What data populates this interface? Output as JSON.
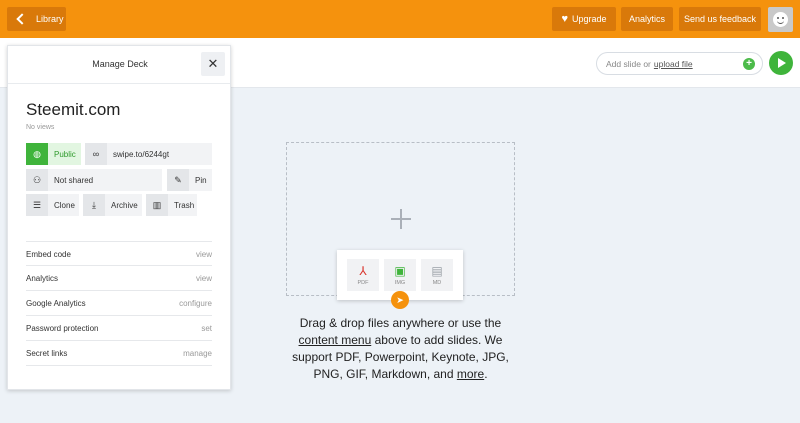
{
  "topbar": {
    "back_label": "Library",
    "upgrade_label": "Upgrade",
    "analytics_label": "Analytics",
    "feedback_label": "Send us feedback",
    "accent_color": "#f5920d"
  },
  "add_slide": {
    "text": "Add slide or",
    "link": "upload file"
  },
  "panel": {
    "title": "Manage Deck",
    "close_glyph": "✕",
    "deck_title": "Steemit.com",
    "views": "No views",
    "chips": {
      "public": "Public",
      "link": "swipe.to/6244gt",
      "shared": "Not shared",
      "pin": "Pin",
      "clone": "Clone",
      "archive": "Archive",
      "trash": "Trash"
    },
    "rows": [
      {
        "label": "Embed code",
        "action": "view"
      },
      {
        "label": "Analytics",
        "action": "view"
      },
      {
        "label": "Google Analytics",
        "action": "configure"
      },
      {
        "label": "Password protection",
        "action": "set"
      },
      {
        "label": "Secret links",
        "action": "manage"
      }
    ]
  },
  "filetypes": [
    {
      "label": "PDF",
      "icon": "pdf-icon"
    },
    {
      "label": "IMG",
      "icon": "image-icon"
    },
    {
      "label": "MD",
      "icon": "markdown-icon"
    }
  ],
  "drop_text": {
    "part1": "Drag & drop files anywhere or use the",
    "link1": "content menu",
    "part2": "above to add slides. We support PDF, Powerpoint, Keynote, JPG, PNG, GIF, Markdown, and",
    "link2": "more",
    "part3": "."
  }
}
